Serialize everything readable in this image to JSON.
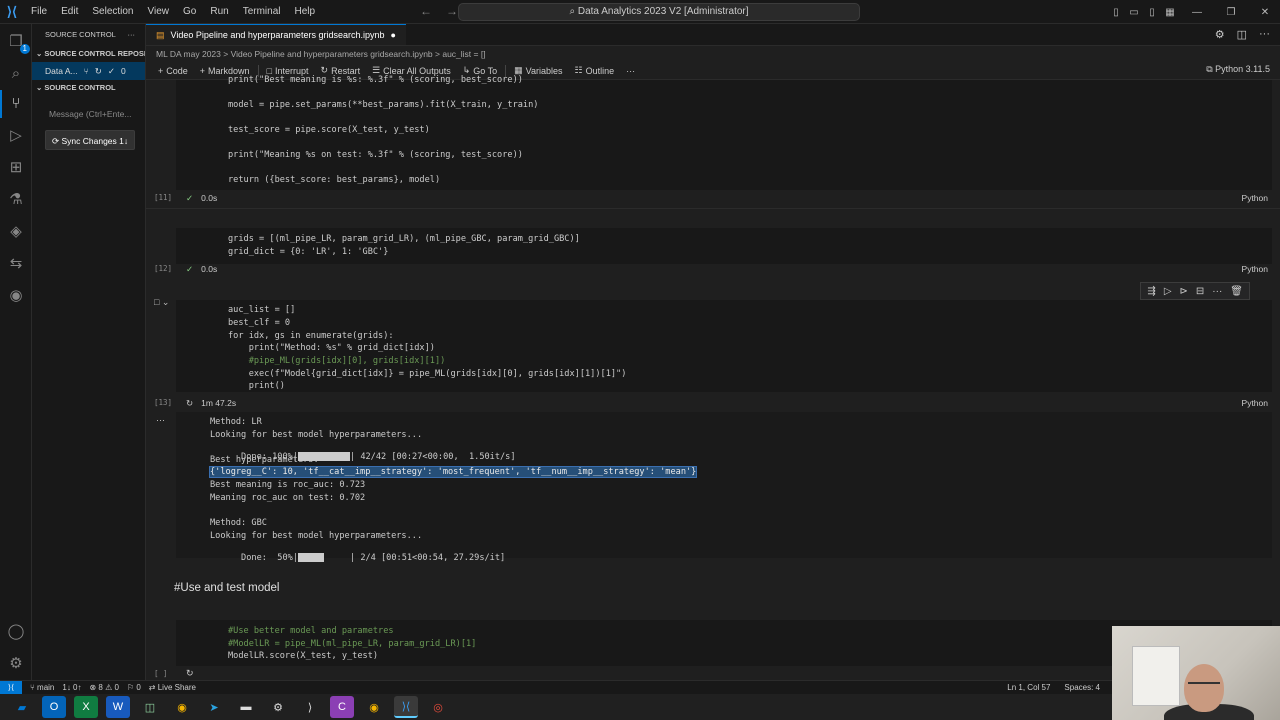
{
  "titlebar": {
    "menu": [
      "File",
      "Edit",
      "Selection",
      "View",
      "Go",
      "Run",
      "Terminal",
      "Help"
    ],
    "command_center": "Data Analytics 2023 V2 [Administrator]"
  },
  "activitybar": {
    "scm_badge": "1"
  },
  "sidebar": {
    "title": "SOURCE CONTROL",
    "section_repos": "SOURCE CONTROL REPOSI...",
    "repo_name": "Data A...",
    "repo_count": "0",
    "section_scm": "SOURCE CONTROL",
    "message_placeholder": "Message (Ctrl+Ente...",
    "sync_button": "Sync Changes 1↓"
  },
  "editor": {
    "tab_title": "Video Pipeline and hyperparameters gridsearch.ipynb",
    "tab_dirty": "●",
    "breadcrumb": "ML DA may 2023 > Video Pipeline and hyperparameters gridsearch.ipynb > auc_list = []",
    "toolbar": {
      "code": "Code",
      "markdown": "Markdown",
      "interrupt": "Interrupt",
      "restart": "Restart",
      "clear": "Clear All Outputs",
      "goto": "Go To",
      "variables": "Variables",
      "outline": "Outline",
      "more": "···"
    },
    "kernel": "Python 3.11.5"
  },
  "cells": {
    "c11": {
      "lines": [
        "print(\"Best meaning is %s: %.3f\" % (scoring, best_score))",
        "model = pipe.set_params(**best_params).fit(X_train, y_train)",
        "test_score = pipe.score(X_test, y_test)",
        "print(\"Meaning %s on test: %.3f\" % (scoring, test_score))",
        "return ({best_score: best_params}, model)"
      ],
      "count": "[11]",
      "time": "0.0s",
      "lang": "Python"
    },
    "c12": {
      "lines": [
        "grids = [(ml_pipe_LR, param_grid_LR), (ml_pipe_GBC, param_grid_GBC)]",
        "grid_dict = {0: 'LR', 1: 'GBC'}"
      ],
      "count": "[12]",
      "time": "0.0s",
      "lang": "Python"
    },
    "c13": {
      "lines": [
        "auc_list = []",
        "best_clf = 0",
        "for idx, gs in enumerate(grids):",
        "    print(\"Method: %s\" % grid_dict[idx])",
        "    #pipe_ML(grids[idx][0], grids[idx][1])",
        "    exec(f\"Model{grid_dict[idx]} = pipe_ML(grids[idx][0], grids[idx][1])[1]\")",
        "    print()"
      ],
      "count": "[13]",
      "time": "1m 47.2s",
      "lang": "Python",
      "output": [
        "Method: LR",
        "Looking for best model hyperparameters...",
        "Done: 100%|",
        "| 42/42 [00:27<00:00,  1.50it/s]",
        "Best hyperparameters:",
        "{'logreg__C': 10, 'tf__cat__imp__strategy': 'most_frequent', 'tf__num__imp__strategy': 'mean'}",
        "Best meaning is roc_auc: 0.723",
        "Meaning roc_auc on test: 0.702",
        "Method: GBC",
        "Looking for best model hyperparameters...",
        "Done:  50%|",
        "| 2/4 [00:51<00:54, 27.29s/it]"
      ],
      "progress_lr": 1.0,
      "progress_gbc": 0.5
    },
    "markdown": "#Use and test model",
    "c14": {
      "lines": [
        "#Use better model and parametres",
        "#ModelLR = pipe_ML(ml_pipe_LR, param_grid_LR)[1]",
        "ModelLR.score(X_test, y_test)"
      ],
      "count": "[ ]"
    }
  },
  "statusbar": {
    "branch": "main",
    "sync": "1↓ 0↑",
    "problems": "⊗ 8 ⚠ 0",
    "ports": "⚐ 0",
    "liveshare": "Live Share",
    "position": "Ln 1, Col 57",
    "spaces": "Spaces: 4"
  }
}
